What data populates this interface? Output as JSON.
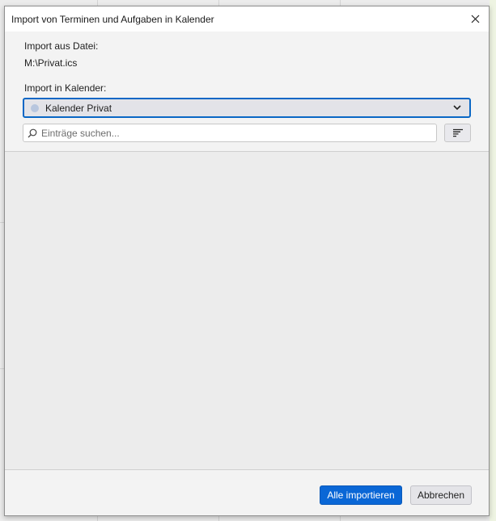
{
  "window": {
    "title": "Import von Terminen und Aufgaben in Kalender"
  },
  "file": {
    "label": "Import aus Datei:",
    "path": "M:\\Privat.ics"
  },
  "calendar": {
    "label": "Import in Kalender:",
    "selected": "Kalender Privat",
    "dot_color": "#b8c6de"
  },
  "search": {
    "placeholder": "Einträge suchen...",
    "value": ""
  },
  "footer": {
    "import_all_label": "Alle importieren",
    "cancel_label": "Abbrechen"
  },
  "colors": {
    "accent": "#0a67d6",
    "focus_border": "#0a67c5"
  },
  "icons": {
    "close": "close-icon",
    "dropdown": "chevron-down-icon",
    "search": "search-icon",
    "sort": "sort-lines-icon"
  }
}
